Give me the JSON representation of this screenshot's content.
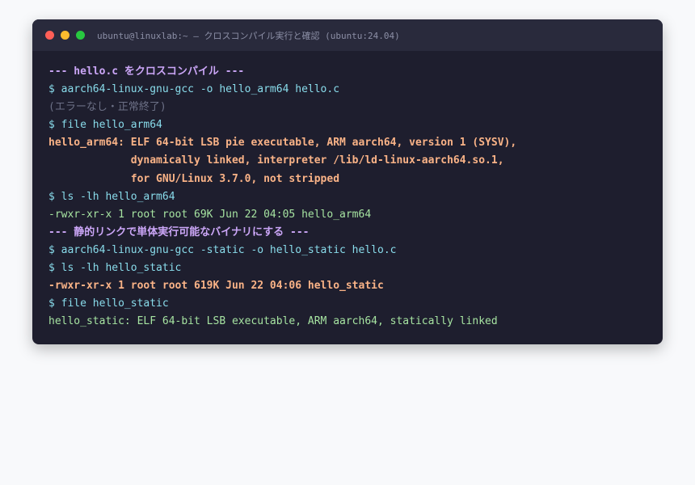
{
  "window": {
    "title": "ubuntu@linuxlab:~ — クロスコンパイル実行と確認 (ubuntu:24.04)"
  },
  "colors": {
    "background": "#1e1e2e",
    "titlebar": "#292a3c",
    "heading": "#cba6f7",
    "command": "#89dceb",
    "comment": "#6c7086",
    "output_bold": "#fab387",
    "output": "#a6e3a1"
  },
  "terminal": {
    "lines": [
      {
        "text": "--- hello.c をクロスコンパイル ---",
        "style": "heading"
      },
      {
        "text": "$ aarch64-linux-gnu-gcc -o hello_arm64 hello.c",
        "style": "cmd"
      },
      {
        "text": "(エラーなし・正常終了)",
        "style": "comment"
      },
      {
        "text": "$ file hello_arm64",
        "style": "cmd"
      },
      {
        "text": "hello_arm64: ELF 64-bit LSB pie executable, ARM aarch64, version 1 (SYSV),",
        "style": "output-bold"
      },
      {
        "text": "             dynamically linked, interpreter /lib/ld-linux-aarch64.so.1,",
        "style": "output-bold"
      },
      {
        "text": "             for GNU/Linux 3.7.0, not stripped",
        "style": "output-bold"
      },
      {
        "text": "$ ls -lh hello_arm64",
        "style": "cmd"
      },
      {
        "text": "-rwxr-xr-x 1 root root 69K Jun 22 04:05 hello_arm64",
        "style": "output"
      },
      {
        "text": "--- 静的リンクで単体実行可能なバイナリにする ---",
        "style": "heading"
      },
      {
        "text": "$ aarch64-linux-gnu-gcc -static -o hello_static hello.c",
        "style": "cmd"
      },
      {
        "text": "$ ls -lh hello_static",
        "style": "cmd"
      },
      {
        "text": "-rwxr-xr-x 1 root root 619K Jun 22 04:06 hello_static",
        "style": "output-bold"
      },
      {
        "text": "$ file hello_static",
        "style": "cmd"
      },
      {
        "text": "hello_static: ELF 64-bit LSB executable, ARM aarch64, statically linked",
        "style": "output"
      }
    ]
  }
}
